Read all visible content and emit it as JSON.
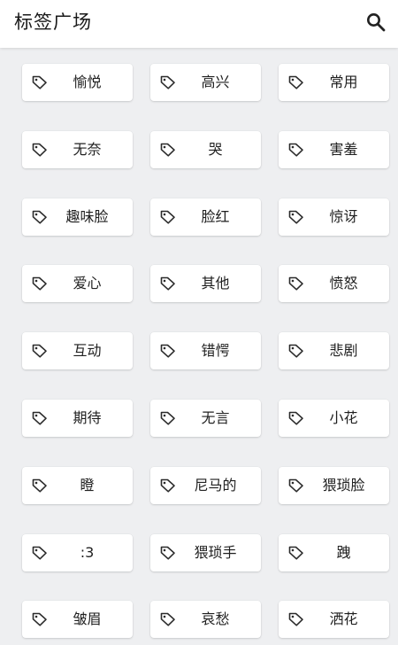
{
  "header": {
    "title": "标签广场",
    "search_icon": "search-icon"
  },
  "tag_icon": "tag-icon",
  "tags": [
    "愉悦",
    "高兴",
    "常用",
    "无奈",
    "哭",
    "害羞",
    "趣味脸",
    "脸红",
    "惊讶",
    "爱心",
    "其他",
    "愤怒",
    "互动",
    "错愕",
    "悲剧",
    "期待",
    "无言",
    "小花",
    "瞪",
    "尼马的",
    "猥琐脸",
    ":3",
    "猥琐手",
    "跩",
    "皱眉",
    "哀愁",
    "洒花"
  ]
}
